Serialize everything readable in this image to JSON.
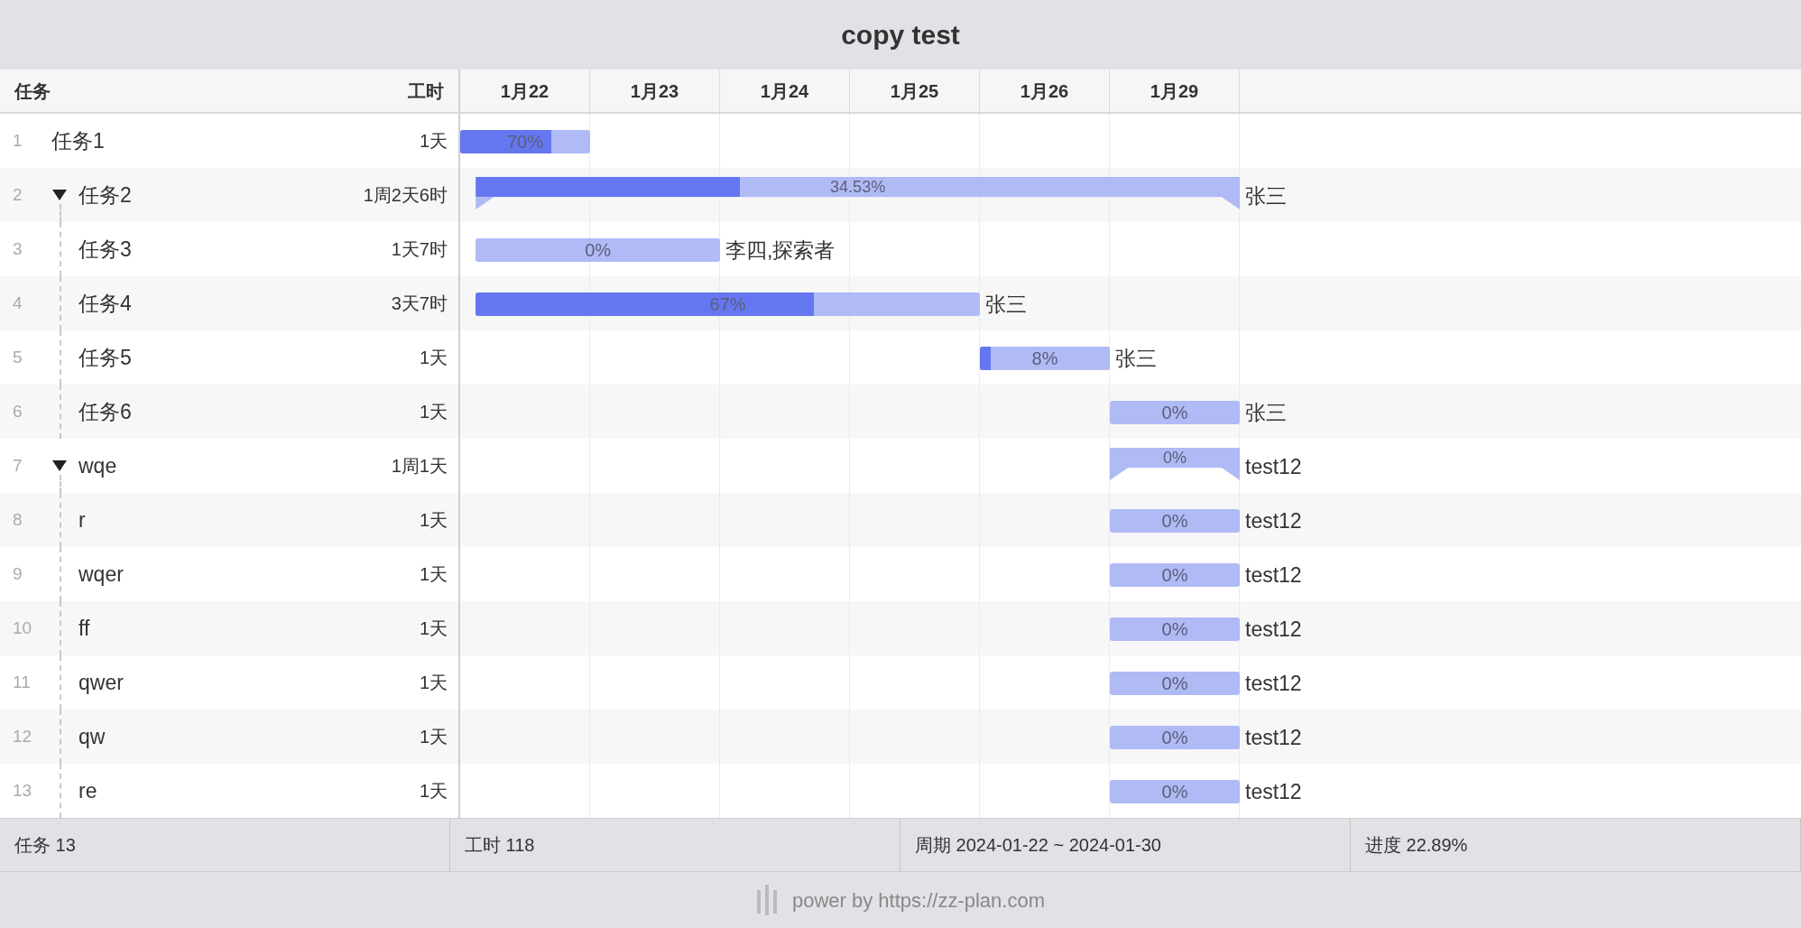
{
  "window": {
    "title": "copy test"
  },
  "table": {
    "columns": [
      "任务",
      "工时"
    ]
  },
  "timeline": {
    "dates": [
      "1月22",
      "1月23",
      "1月24",
      "1月25",
      "1月26",
      "1月29"
    ]
  },
  "tasks": [
    {
      "num": "1",
      "name": "任务1",
      "hours": "1天",
      "bar": {
        "kind": "task",
        "level": 0.7,
        "label": "70%"
      }
    },
    {
      "num": "2",
      "name": "任务2",
      "hours": "1周2天6时",
      "expanded": true,
      "bar": {
        "kind": "summary",
        "level": 0.3453,
        "label": "34.53%",
        "assignee": "张三"
      },
      "children": [
        {
          "num": "3",
          "name": "任务3",
          "hours": "1天7时",
          "bar": {
            "kind": "task",
            "level": 0,
            "label": "0%",
            "assignee": "李四,探索者"
          }
        },
        {
          "num": "4",
          "name": "任务4",
          "hours": "3天7时",
          "bar": {
            "kind": "task",
            "level": 0.67,
            "label": "67%",
            "assignee": "张三"
          }
        },
        {
          "num": "5",
          "name": "任务5",
          "hours": "1天",
          "bar": {
            "kind": "task",
            "level": 0.08,
            "label": "8%",
            "assignee": "张三"
          }
        },
        {
          "num": "6",
          "name": "任务6",
          "hours": "1天",
          "bar": {
            "kind": "task",
            "level": 0,
            "label": "0%",
            "assignee": "张三"
          }
        }
      ]
    },
    {
      "num": "7",
      "name": "wqe",
      "hours": "1周1天",
      "expanded": true,
      "bar": {
        "kind": "summary",
        "level": 0,
        "label": "0%",
        "assignee": "test12"
      },
      "children": [
        {
          "num": "8",
          "name": "r",
          "hours": "1天",
          "bar": {
            "kind": "task",
            "level": 0,
            "label": "0%",
            "assignee": "test12"
          }
        },
        {
          "num": "9",
          "name": "wqer",
          "hours": "1天",
          "bar": {
            "kind": "task",
            "level": 0,
            "label": "0%",
            "assignee": "test12"
          }
        },
        {
          "num": "10",
          "name": "ff",
          "hours": "1天",
          "bar": {
            "kind": "task",
            "level": 0,
            "label": "0%",
            "assignee": "test12"
          }
        },
        {
          "num": "11",
          "name": "qwer",
          "hours": "1天",
          "bar": {
            "kind": "task",
            "level": 0,
            "label": "0%",
            "assignee": "test12"
          }
        },
        {
          "num": "12",
          "name": "qw",
          "hours": "1天",
          "bar": {
            "kind": "task",
            "level": 0,
            "label": "0%",
            "assignee": "test12"
          }
        },
        {
          "num": "13",
          "name": "re",
          "hours": "1天",
          "bar": {
            "kind": "task",
            "level": 0,
            "label": "0%",
            "assignee": "test12"
          }
        }
      ]
    }
  ],
  "status_bar": [
    "任务 13",
    "工时 118",
    "周期 2024-01-22 ~ 2024-01-30",
    "进度 22.89%"
  ],
  "footer": {
    "text": "power by https://zz-plan.com"
  }
}
